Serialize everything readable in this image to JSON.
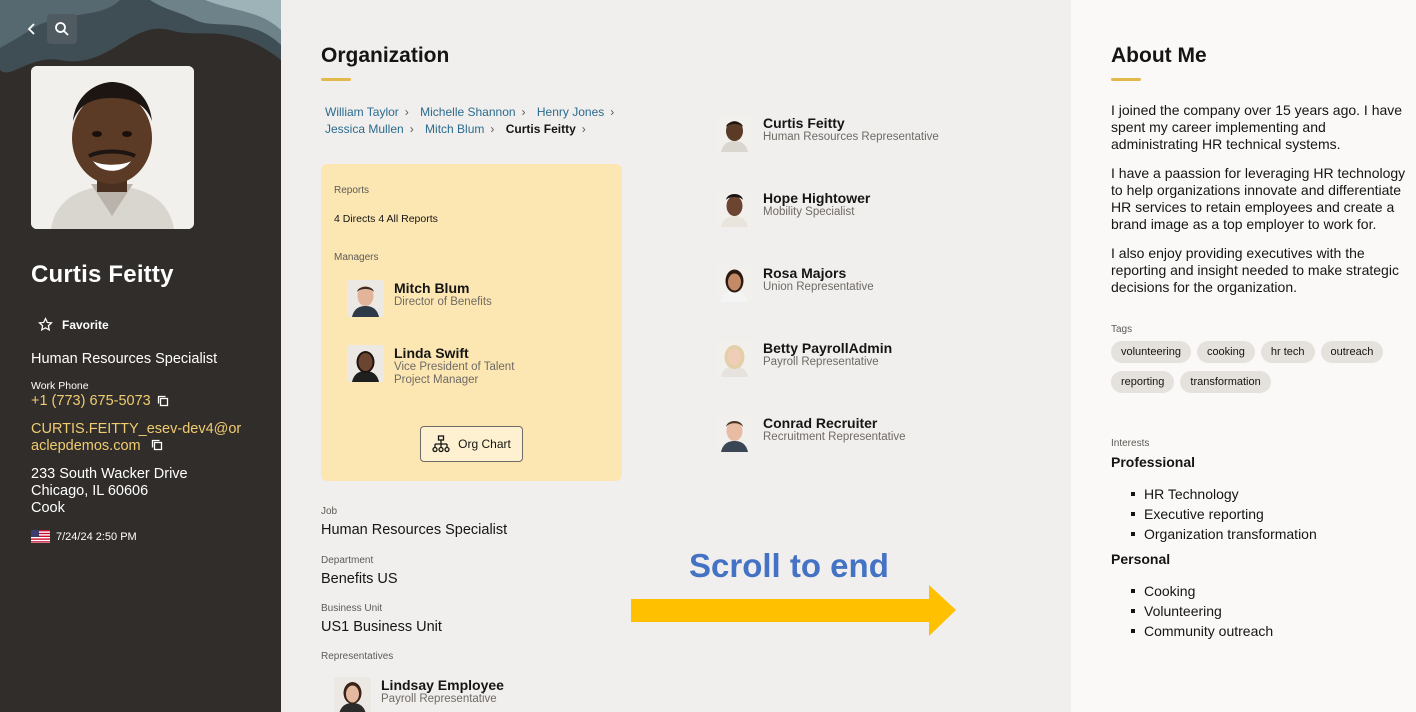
{
  "profile": {
    "name": "Curtis Feitty",
    "favorite_label": "Favorite",
    "title": "Human Resources Specialist",
    "work_phone_label": "Work Phone",
    "work_phone": "+1 (773) 675-5073",
    "email": "CURTIS.FEITTY_esev-dev4@oraclepdemos.com",
    "address_line1": "233 South Wacker Drive",
    "address_line2": "Chicago, IL 60606",
    "address_line3": "Cook",
    "local_time": "7/24/24 2:50 PM",
    "icons": {
      "back": "chevron-left-icon",
      "search": "search-icon",
      "favorite": "star-outline-icon",
      "copy": "copy-icon",
      "flag": "us-flag-icon"
    }
  },
  "organization": {
    "title": "Organization",
    "breadcrumb": [
      "William Taylor",
      "Michelle Shannon",
      "Henry Jones",
      "Jessica Mullen",
      "Mitch Blum",
      "Curtis Feitty"
    ],
    "reports_label": "Reports",
    "reports_count": "4 Directs 4 All Reports",
    "managers_label": "Managers",
    "managers": [
      {
        "name": "Mitch Blum",
        "role": "Director of Benefits",
        "role2": ""
      },
      {
        "name": "Linda Swift",
        "role": "Vice President of Talent",
        "role2": "Project Manager"
      }
    ],
    "org_chart_label": "Org Chart",
    "job_label": "Job",
    "job": "Human Resources Specialist",
    "department_label": "Department",
    "department": "Benefits US",
    "business_unit_label": "Business Unit",
    "business_unit": "US1 Business Unit",
    "representatives_label": "Representatives",
    "representatives": [
      {
        "name": "Lindsay Employee",
        "role": "Payroll Representative"
      }
    ],
    "team": [
      {
        "name": "Curtis Feitty",
        "role": "Human Resources Representative"
      },
      {
        "name": "Hope Hightower",
        "role": "Mobility Specialist"
      },
      {
        "name": "Rosa Majors",
        "role": "Union Representative"
      },
      {
        "name": "Betty PayrollAdmin",
        "role": "Payroll Representative"
      },
      {
        "name": "Conrad Recruiter",
        "role": "Recruitment Representative"
      }
    ]
  },
  "annotation": {
    "text": "Scroll to end",
    "color": "#4472c4",
    "arrow_color": "#ffc000"
  },
  "about": {
    "title": "About Me",
    "paragraphs": [
      "I joined the company over 15 years ago.  I have spent my career implementing and administrating HR technical systems.",
      "I have a paassion for leveraging HR technology to help organizations innovate and differentiate HR services to retain employees and create a brand image as a top employer to work for.",
      "I also enjoy providing executives with the reporting and insight needed to make strategic decisions for the organization."
    ],
    "tags_label": "Tags",
    "tags": [
      "volunteering",
      "cooking",
      "hr tech",
      "outreach",
      "reporting",
      "transformation"
    ],
    "interests_label": "Interests",
    "professional_label": "Professional",
    "professional": [
      "HR Technology",
      "Executive reporting",
      "Organization transformation"
    ],
    "personal_label": "Personal",
    "personal": [
      "Cooking",
      "Volunteering",
      "Community outreach"
    ]
  },
  "colors": {
    "sidebar_bg": "#312d2a",
    "accent_gold": "#e2b94a",
    "link": "#2a6b8e",
    "card_bg": "#fce7b3",
    "phone_text": "#f0cc71"
  }
}
